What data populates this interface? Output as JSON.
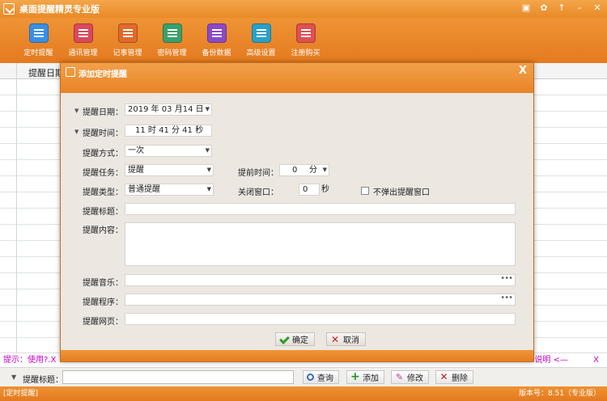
{
  "app": {
    "title": "桌面提醒精灵专业版",
    "colors": {
      "brand": "#e98a26"
    }
  },
  "window_controls": [
    "tray-icon",
    "skin-icon",
    "arrow-icon",
    "minimize-icon",
    "close-icon"
  ],
  "toolbar": {
    "items": [
      {
        "label": "定时提醒",
        "icon": "alarm-clock-icon",
        "color": "#3a8ee6"
      },
      {
        "label": "通讯管理",
        "icon": "address-book-icon",
        "color": "#d94a5a"
      },
      {
        "label": "记事管理",
        "icon": "notepad-icon",
        "color": "#e06a2a"
      },
      {
        "label": "密码管理",
        "icon": "password-icon",
        "color": "#3aa06a"
      },
      {
        "label": "备份数据",
        "icon": "backup-icon",
        "color": "#8a4ac6"
      },
      {
        "label": "高级设置",
        "icon": "settings-icon",
        "color": "#2aa0c6"
      },
      {
        "label": "注册购买",
        "icon": "purchase-icon",
        "color": "#e05050"
      }
    ]
  },
  "grid": {
    "column_header": "提醒日期"
  },
  "hint": {
    "text": "提示：使用?.X",
    "right_text": "说明 <—",
    "close": "X"
  },
  "searchbar": {
    "label": "提醒标题：",
    "buttons": {
      "search": "查询",
      "add": "添加",
      "edit": "修改",
      "delete": "删除"
    }
  },
  "status": {
    "left": "[定时提醒]",
    "right": "版本号：8.51（专业版）"
  },
  "dialog": {
    "title": "添加定时提醒",
    "close": "X",
    "date_label": "提醒日期：",
    "date_value": "2019 年 03 月14 日",
    "time_label": "提醒时间：",
    "time_value": "11 时 41 分 41 秒",
    "method_label": "提醒方式：",
    "method_value": "一次",
    "task_label": "提醒任务：",
    "task_value": "提醒",
    "advance_label": "提前时间：",
    "advance_value": "0",
    "advance_unit": "分",
    "type_label": "提醒类型：",
    "type_value": "普通提醒",
    "close_window_label": "关闭窗口：",
    "close_window_value": "0",
    "close_window_unit": "秒",
    "no_popup_label": "不弹出提醒窗口",
    "no_popup_checked": false,
    "subject_label": "提醒标题：",
    "subject_value": "",
    "content_label": "提醒内容：",
    "content_value": "",
    "music_label": "提醒音乐：",
    "music_value": "",
    "program_label": "提醒程序：",
    "program_value": "",
    "webpage_label": "提醒网页：",
    "webpage_value": "",
    "browse_dots": "•••",
    "ok_label": "确定",
    "cancel_label": "取消"
  }
}
